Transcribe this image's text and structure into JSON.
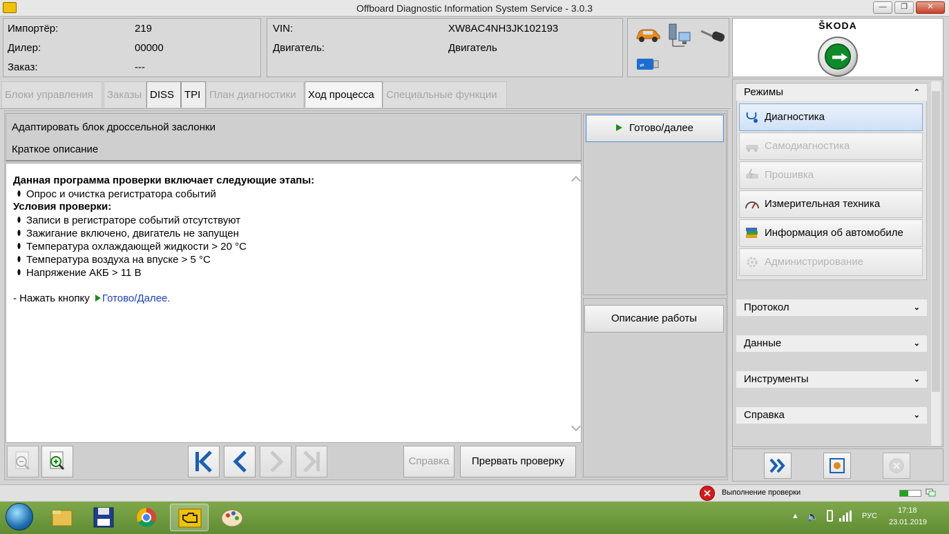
{
  "window": {
    "title": "Offboard Diagnostic Information System Service - 3.0.3",
    "controls": [
      "minimize",
      "restore",
      "close"
    ]
  },
  "header": {
    "importer_label": "Импортёр:",
    "importer_value": "219",
    "dealer_label": "Дилер:",
    "dealer_value": "00000",
    "order_label": "Заказ:",
    "order_value": "---",
    "vin_label": "VIN:",
    "vin_value": "XW8AC4NH3JK102193",
    "engine_label": "Двигатель:",
    "engine_value": "Двигатель",
    "icons": [
      "car-icon",
      "network-icon",
      "key-icon",
      "usb-icon"
    ],
    "brand": "ŠKODA"
  },
  "tabs": [
    {
      "label": "Блоки управления",
      "enabled": false
    },
    {
      "label": "Заказы",
      "enabled": false
    },
    {
      "label": "DISS",
      "enabled": true
    },
    {
      "label": "TPI",
      "enabled": true
    },
    {
      "label": "План диагностики",
      "enabled": false
    },
    {
      "label": "Ход процесса",
      "enabled": true,
      "selected": true
    },
    {
      "label": "Специальные функции",
      "enabled": false
    }
  ],
  "procedure": {
    "title": "Адаптировать блок дроссельной заслонки",
    "subtitle": "Краткое описание",
    "heading1": "Данная программа проверки включает следующие этапы:",
    "steps": [
      "Опрос и очистка регистратора событий"
    ],
    "heading2": "Условия проверки:",
    "conditions": [
      "Записи в регистраторе событий отсутствуют",
      "Зажигание включено, двигатель не запущен",
      "Температура охлаждающей жидкости > 20 °C",
      "Температура воздуха на впуске > 5 °C",
      "Напряжение АКБ > 11 В"
    ],
    "instruction_prefix": "- Нажать кнопку",
    "instruction_link": "Готово/Далее."
  },
  "actions": {
    "ready_next": "Готово/далее",
    "work_description": "Описание работы"
  },
  "toolbar": {
    "help": "Справка",
    "abort": "Прервать проверку",
    "icons": [
      "zoom-out-icon",
      "zoom-in-icon",
      "first-icon",
      "back-icon",
      "forward-icon",
      "last-icon"
    ]
  },
  "sidebar": {
    "modes_title": "Режимы",
    "modes": [
      {
        "label": "Диагностика",
        "state": "active",
        "icon": "stethoscope-icon"
      },
      {
        "label": "Самодиагностика",
        "state": "disabled",
        "icon": "car-icon"
      },
      {
        "label": "Прошивка",
        "state": "disabled",
        "icon": "car-flash-icon"
      },
      {
        "label": "Измерительная техника",
        "state": "enabled",
        "icon": "gauge-icon"
      },
      {
        "label": "Информация об автомобиле",
        "state": "enabled",
        "icon": "books-icon"
      },
      {
        "label": "Администрирование",
        "state": "disabled",
        "icon": "gear-icon"
      }
    ],
    "sections": [
      "Протокол",
      "Данные",
      "Инструменты",
      "Справка"
    ]
  },
  "status": {
    "text": "Выполнение проверки",
    "progress": 0.4
  },
  "taskbar": {
    "apps": [
      "start-orb-icon",
      "explorer-icon",
      "save-icon",
      "chrome-icon",
      "odis-icon",
      "paint-icon"
    ],
    "lang": "РУС",
    "time": "17:18",
    "date": "23.01.2019"
  },
  "colors": {
    "accent": "#1b5fb4",
    "link": "#1a3fc0",
    "green": "#1b8c1b",
    "error": "#d41c1c"
  }
}
